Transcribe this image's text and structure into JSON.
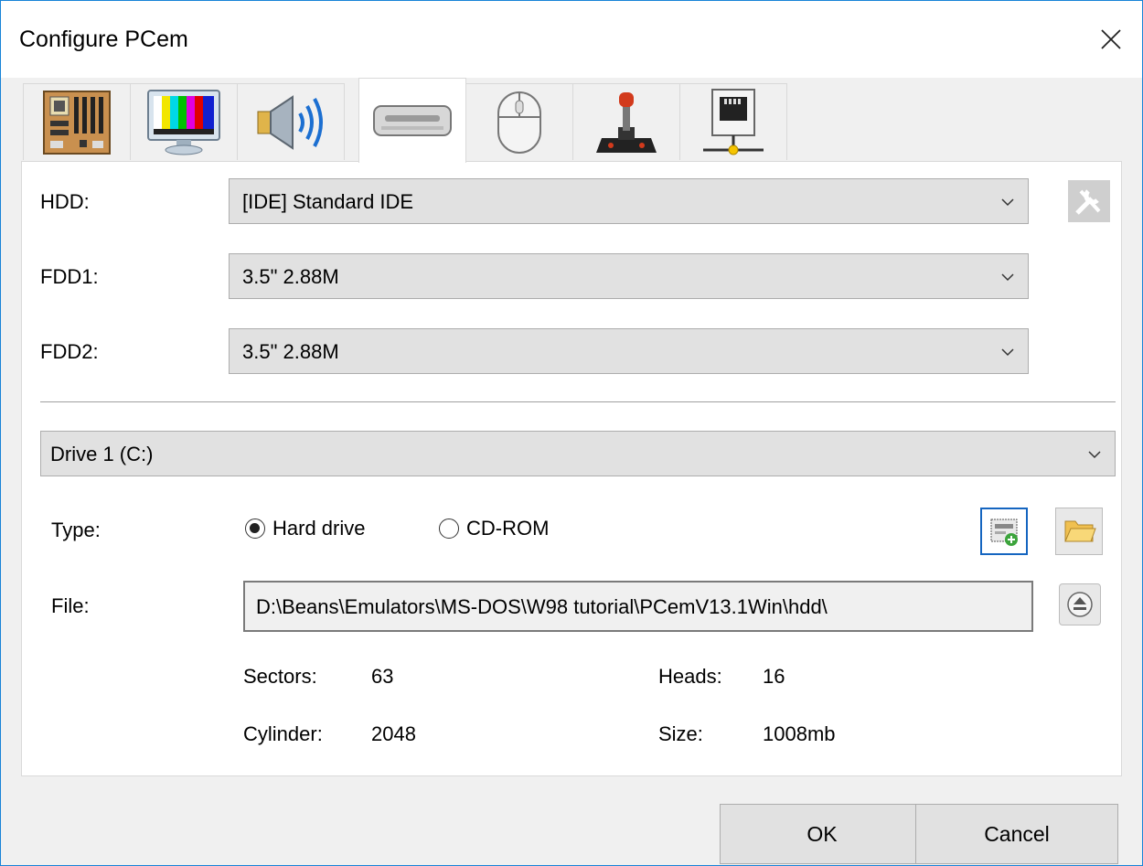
{
  "window": {
    "title": "Configure PCem"
  },
  "tabs": [
    {
      "icon": "motherboard-icon"
    },
    {
      "icon": "display-icon"
    },
    {
      "icon": "speaker-icon"
    },
    {
      "icon": "drive-icon",
      "active": true
    },
    {
      "icon": "mouse-icon"
    },
    {
      "icon": "joystick-icon"
    },
    {
      "icon": "network-icon"
    }
  ],
  "hdd": {
    "label": "HDD:",
    "value": "[IDE] Standard IDE"
  },
  "fdd1": {
    "label": "FDD1:",
    "value": "3.5\" 2.88M"
  },
  "fdd2": {
    "label": "FDD2:",
    "value": "3.5\" 2.88M"
  },
  "drive": {
    "value": "Drive 1 (C:)"
  },
  "type": {
    "label": "Type:",
    "hard_drive": "Hard drive",
    "cdrom": "CD-ROM",
    "selected": "hard_drive"
  },
  "file": {
    "label": "File:",
    "value": "D:\\Beans\\Emulators\\MS-DOS\\W98 tutorial\\PCemV13.1Win\\hdd\\"
  },
  "geometry": {
    "sectors_label": "Sectors:",
    "sectors": "63",
    "heads_label": "Heads:",
    "heads": "16",
    "cylinder_label": "Cylinder:",
    "cylinder": "2048",
    "size_label": "Size:",
    "size": "1008mb"
  },
  "buttons": {
    "ok": "OK",
    "cancel": "Cancel"
  }
}
